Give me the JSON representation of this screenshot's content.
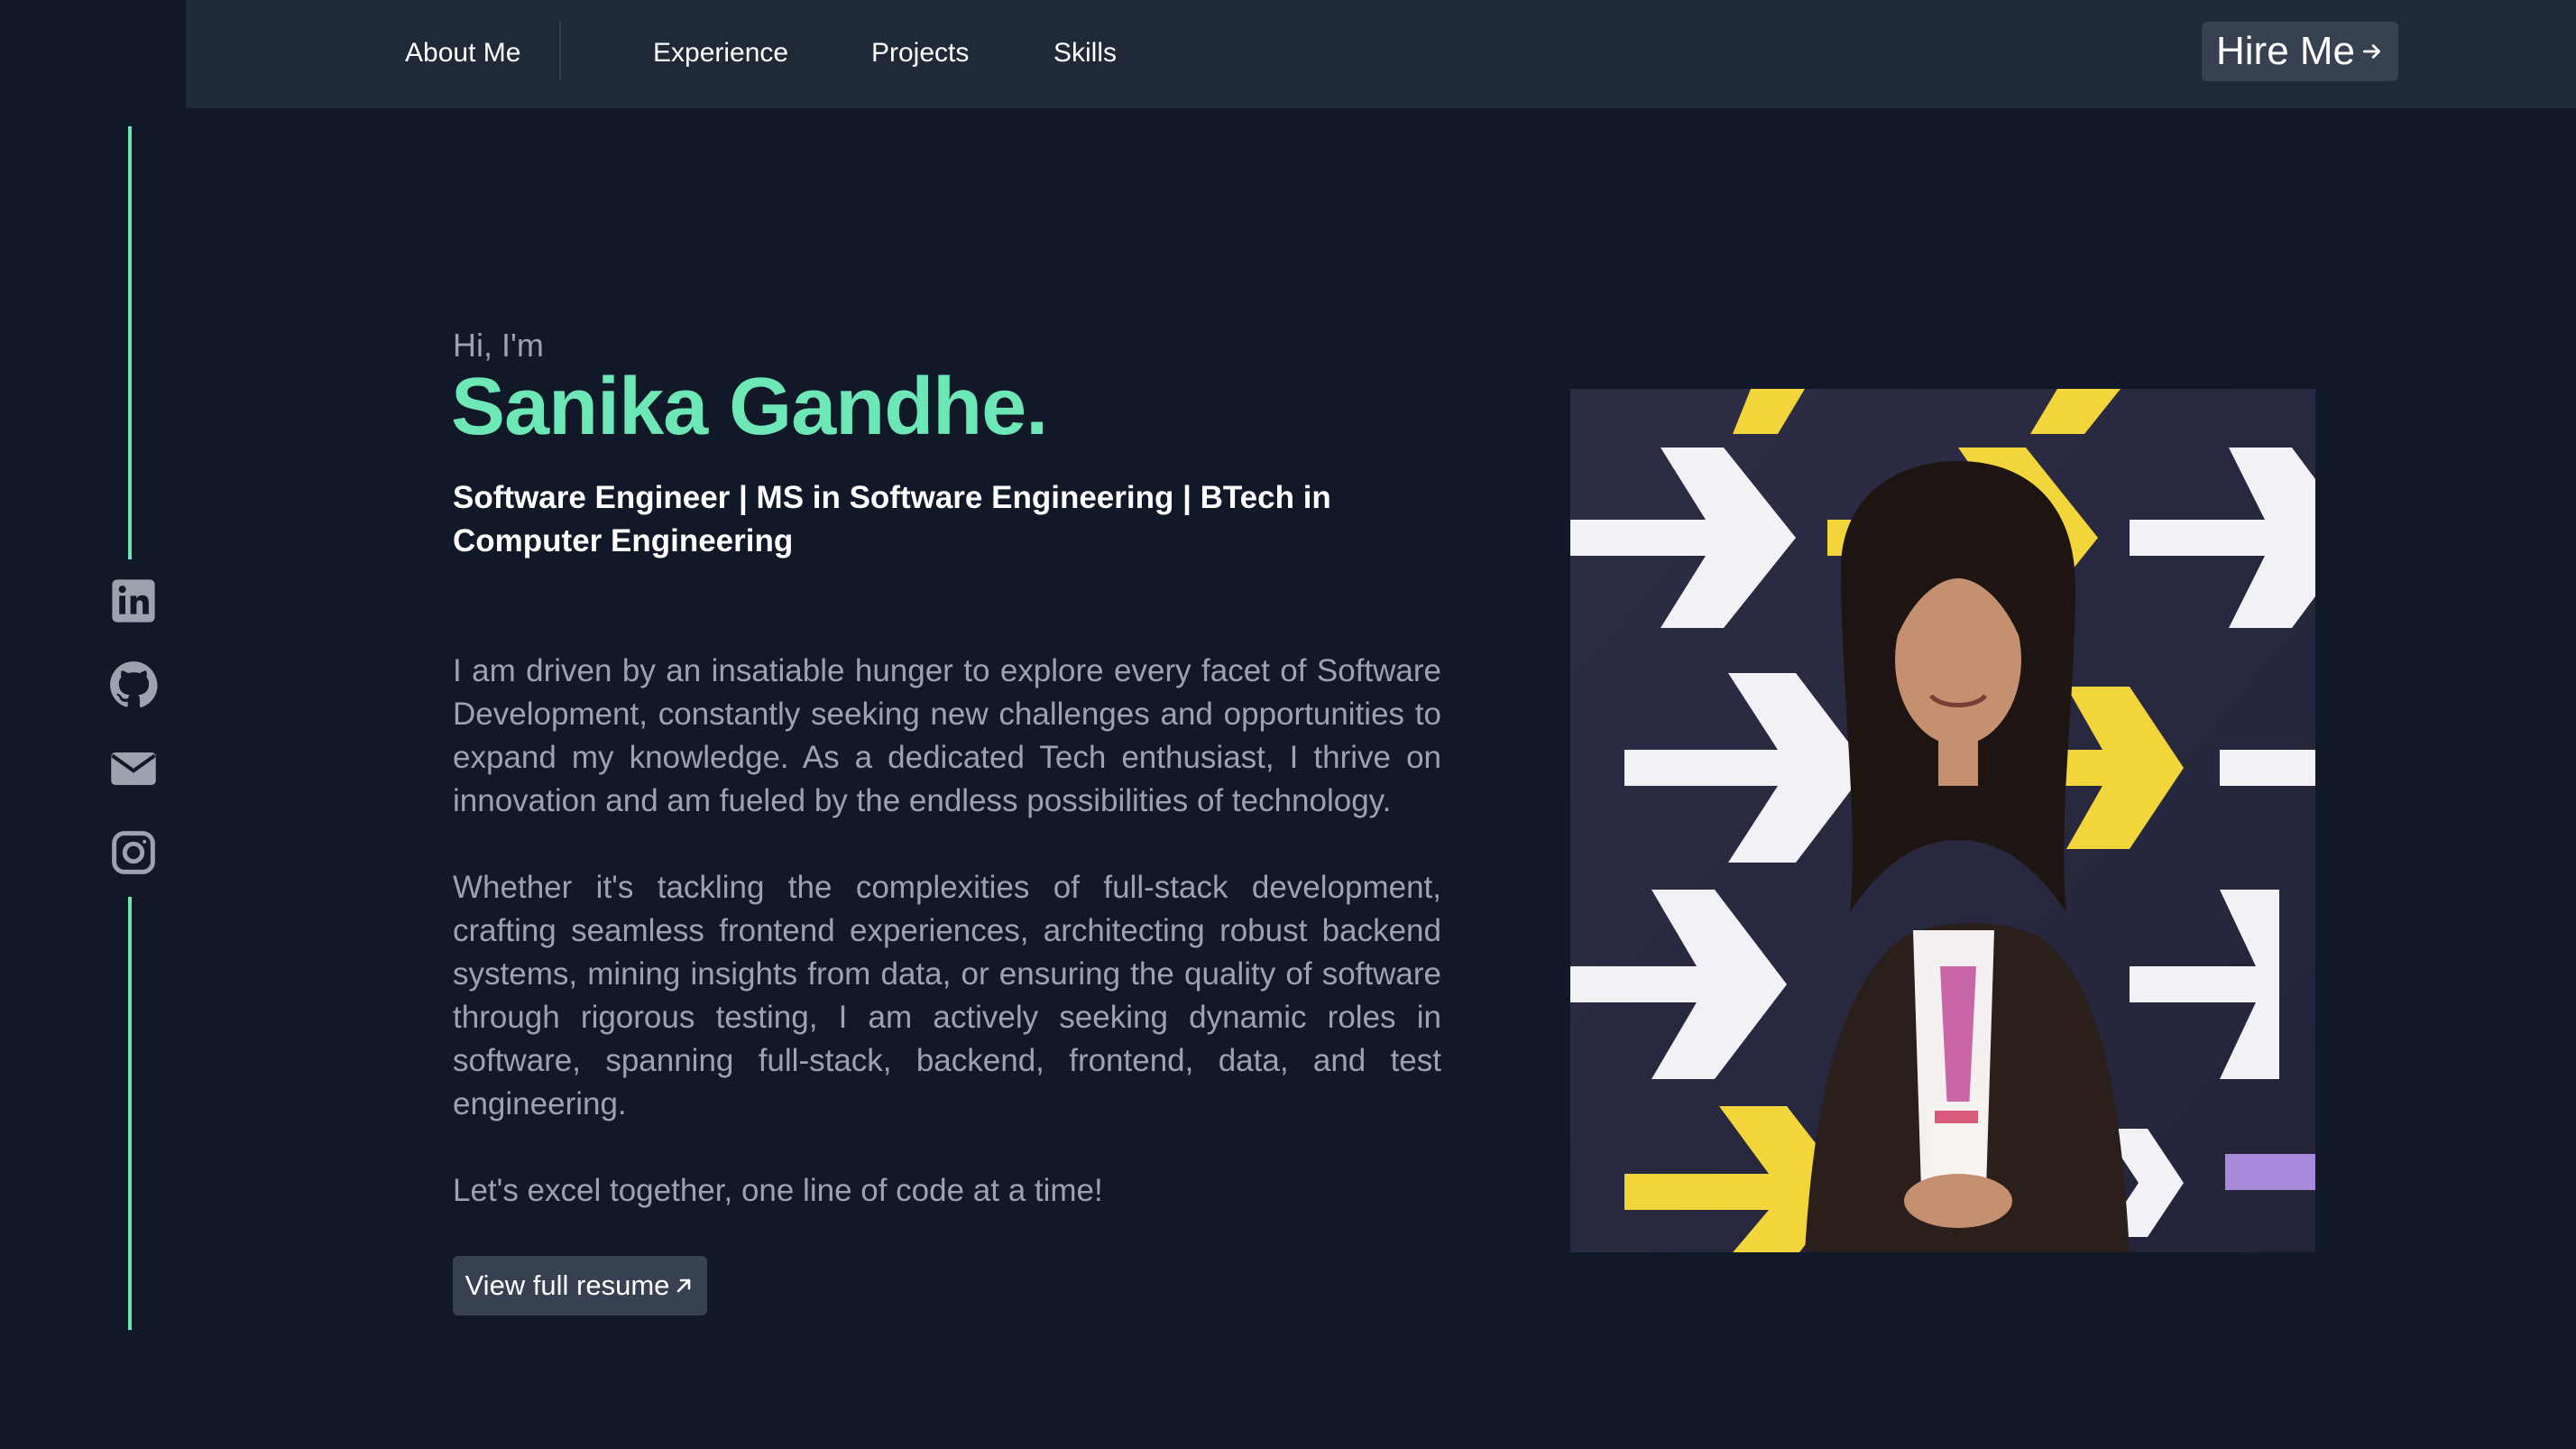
{
  "nav": {
    "links": [
      "About Me",
      "Experience",
      "Projects",
      "Skills"
    ],
    "hire_label": "Hire Me"
  },
  "social": {
    "icons": [
      "linkedin-icon",
      "github-icon",
      "mail-icon",
      "instagram-icon"
    ],
    "rail_color": "#6ee7b7"
  },
  "hero": {
    "greeting": "Hi, I'm",
    "name": "Sanika Gandhe.",
    "headline": "Software Engineer | MS in Software Engineering | BTech in Computer Engineering",
    "bio_1": "I am driven by an insatiable hunger to explore every facet of Software Development, constantly seeking new challenges and opportunities to expand my knowledge. As a dedicated Tech enthusiast, I thrive on innovation and am fueled by the endless possibilities of technology.",
    "bio_2": "Whether it's tackling the complexities of full-stack development, crafting seamless frontend experiences, architecting robust backend systems, mining insights from data, or ensuring the quality of software through rigorous testing, I am actively seeking dynamic roles in software, spanning full-stack, backend, frontend, data, and test engineering.",
    "bio_3": "Let's excel together, one line of code at a time!",
    "resume_label": "View full resume"
  },
  "colors": {
    "background": "#111827",
    "navbar": "#1f2937",
    "accent": "#6ee7b7",
    "button": "#374151",
    "muted_text": "#9ca3af"
  }
}
